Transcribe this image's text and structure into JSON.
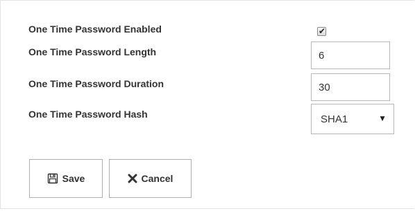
{
  "form": {
    "otp_enabled_label": "One Time Password Enabled",
    "otp_enabled_checked": true,
    "otp_length_label": "One Time Password Length",
    "otp_length_value": "6",
    "otp_duration_label": "One Time Password Duration",
    "otp_duration_value": "30",
    "otp_hash_label": "One Time Password Hash",
    "otp_hash_value": "SHA1"
  },
  "buttons": {
    "save_label": "Save",
    "save_icon": "floppy-disk-icon",
    "cancel_label": "Cancel",
    "cancel_icon": "x-icon"
  }
}
